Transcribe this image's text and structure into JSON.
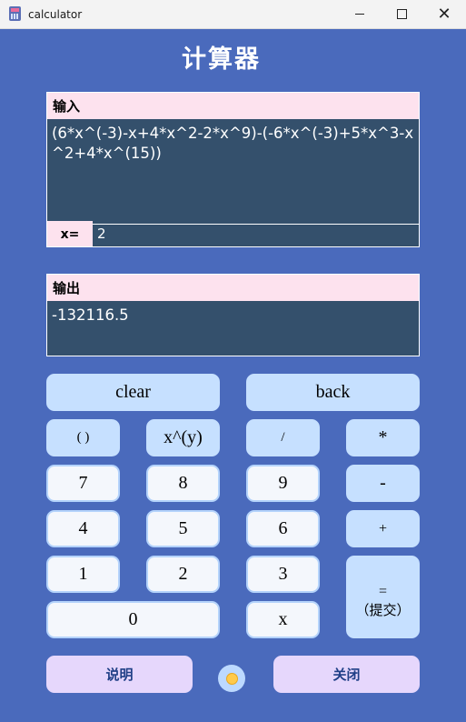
{
  "window": {
    "title": "calculator",
    "controls": {
      "minimize": "—",
      "maximize": "□",
      "close": "✕"
    }
  },
  "app": {
    "title": "计算器"
  },
  "input": {
    "label": "输入",
    "expression": "(6*x^(-3)-x+4*x^2-2*x^9)-(-6*x^(-3)+5*x^3-x^2+4*x^(15))",
    "x_label": "x=",
    "x_value": "2"
  },
  "output": {
    "label": "输出",
    "value": "-132116.5"
  },
  "keys": {
    "clear": "clear",
    "back": "back",
    "paren": "( )",
    "power": "x^(y)",
    "divide": "/",
    "multiply": "*",
    "minus": "-",
    "plus": "+",
    "d7": "7",
    "d8": "8",
    "d9": "9",
    "d4": "4",
    "d5": "5",
    "d6": "6",
    "d1": "1",
    "d2": "2",
    "d3": "3",
    "d0": "0",
    "x": "x",
    "equals": "=",
    "submit": "（提交）"
  },
  "footer": {
    "help": "说明",
    "close": "关闭"
  },
  "colors": {
    "background": "#4a6abc",
    "panel": "#34506c",
    "label_bg": "#fde2ee",
    "op_key": "#c6e0ff",
    "num_key": "#f4f7fc",
    "footer_key": "#e6d7fc",
    "status_dot": "#ffca4a"
  }
}
